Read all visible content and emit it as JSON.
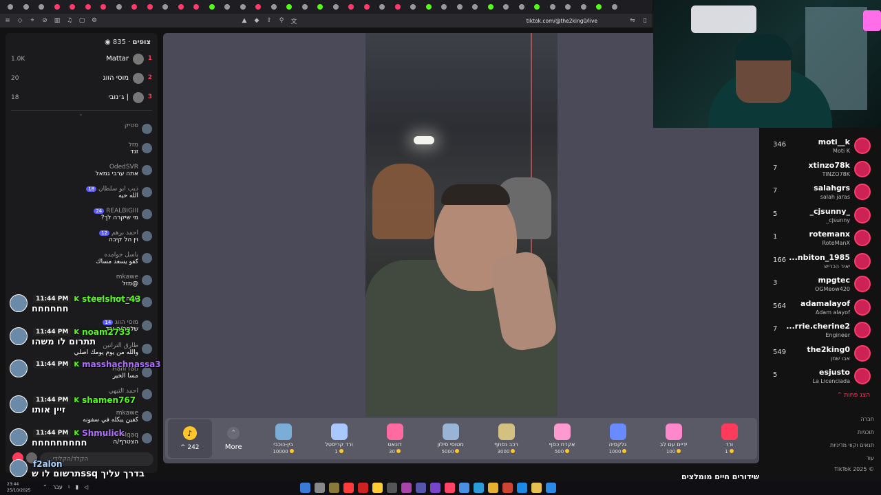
{
  "browser": {
    "url": "tiktok.com/@the2king0/live",
    "tab_colors": [
      "#999",
      "#999",
      "#999",
      "#ff3b6b",
      "#ff3b6b",
      "#ff3b6b",
      "#ff3b6b",
      "#999",
      "#ff3b6b",
      "#ff3b6b",
      "#999",
      "#ff3b6b",
      "#ff3b6b",
      "#53fc18",
      "#999",
      "#999",
      "#ff3b6b",
      "#999",
      "#53fc18",
      "#999",
      "#53fc18",
      "#999",
      "#ff3b6b",
      "#ff3b6b",
      "#999",
      "#ff3b6b",
      "#999",
      "#53fc18",
      "#999",
      "#999",
      "#999",
      "#53fc18",
      "#999",
      "#999",
      "#53fc18",
      "#999",
      "#999",
      "#999",
      "#53fc18",
      "#999"
    ]
  },
  "leftpanel": {
    "viewers_label": "צופים",
    "viewers_count": "835",
    "top_viewers": [
      {
        "rank": "1",
        "name": "Mattar",
        "score": "1.0K"
      },
      {
        "rank": "2",
        "name": "מוסי הווג",
        "score": "20"
      },
      {
        "rank": "3",
        "name": "ג׳נובי |",
        "score": "18"
      }
    ],
    "messages": [
      {
        "user": "סטיק",
        "text": ""
      },
      {
        "user": "מזל",
        "text": "זנד"
      },
      {
        "user": "OdedSVR",
        "text": "אתה ערבי גמאל"
      },
      {
        "user": "ذيب ابو سلطان",
        "text": "الله حيه",
        "badge": "18"
      },
      {
        "user": "REALBIGIII",
        "text": "מי שיקרה לך?",
        "badge": "24"
      },
      {
        "user": "احمد برهم",
        "text": "וין הל קיבה",
        "badge": "12"
      },
      {
        "user": "باسل حوامده",
        "text": "كفو يسعد مساك"
      },
      {
        "user": "mkawe",
        "text": "@מזל"
      },
      {
        "user": "",
        "text": "אתה ערבי ג׳מאל"
      },
      {
        "user": "מוסי הווג",
        "text": "שלחה/ה ורד",
        "badge": "14"
      },
      {
        "user": "طارق التراتين",
        "text": "والله من يوم يومك اصلي"
      },
      {
        "user": "Hani fatl",
        "text": "مسا الخير"
      },
      {
        "user": "احمد التيهي",
        "text": ""
      },
      {
        "user": "mkawe",
        "text": "كفين يبكله في سفونه"
      },
      {
        "user": "Mohamad Alqaq",
        "text": "הצטרף/ה"
      }
    ],
    "input_placeholder": "הקלד/הקלידי..."
  },
  "overlay_chat": [
    {
      "time": "11:44 PM",
      "name": "steelshot_43",
      "color": "#53fc18",
      "text": "חחחחחח"
    },
    {
      "time": "11:44 PM",
      "name": "noam2733",
      "color": "#53fc18",
      "text": "תתרום לו משהו"
    },
    {
      "time": "11:44 PM",
      "name": "masshachnassa3",
      "color": "#b070ff",
      "text": ""
    },
    {
      "time": "11:44 PM",
      "name": "shamen767",
      "color": "#53fc18",
      "text": "זיין אותו"
    },
    {
      "time": "11:44 PM",
      "name": "Shmulick",
      "color": "#b070ff",
      "text": "חחחחחחחחח"
    },
    {
      "time": "",
      "name": "f2alon",
      "color": "#aad4ff",
      "text": "בדרך עליך ssqתרשום לו ש"
    }
  ],
  "stage": {
    "coins": "242",
    "more_label": "More",
    "gifts": [
      {
        "name": "בין-כוכבי",
        "price": "10000",
        "color": "#7aaed8"
      },
      {
        "name": "ורד קריסטל",
        "price": "1",
        "color": "#a8c8ff"
      },
      {
        "name": "דונאט",
        "price": "30",
        "color": "#ff6aa0"
      },
      {
        "name": "מטוסי סילון",
        "price": "5000",
        "color": "#9ab4d8"
      },
      {
        "name": "רכב נסחף",
        "price": "3000",
        "color": "#d4c080"
      },
      {
        "name": "אקדח כסף",
        "price": "500",
        "color": "#ff9ad0"
      },
      {
        "name": "גלקסיה",
        "price": "1000",
        "color": "#6a8aff"
      },
      {
        "name": "ידיים עם לב",
        "price": "100",
        "color": "#ff88cc"
      },
      {
        "name": "ורד",
        "price": "1",
        "color": "#ff3b5c"
      }
    ]
  },
  "rightpanel": {
    "rows": [
      {
        "score": "346",
        "name": "moti__k",
        "sub": "Moti K"
      },
      {
        "score": "7",
        "name": "xtinzo78k",
        "sub": "TINZO78K"
      },
      {
        "score": "7",
        "name": "salahgrs",
        "sub": "salah jaras"
      },
      {
        "score": "5",
        "name": "_cjsunny_",
        "sub": "_cjsunny"
      },
      {
        "score": "1",
        "name": "rotemanx",
        "sub": "RoteManX"
      },
      {
        "score": "166",
        "name": "...nbiton_1985",
        "sub": "יאיר הכריש"
      },
      {
        "score": "3",
        "name": "mpgtec",
        "sub": "OGMeow420"
      },
      {
        "score": "564",
        "name": "adamalayof",
        "sub": "Adam alayof"
      },
      {
        "score": "7",
        "name": "...rrie.cherine2",
        "sub": "Engineer"
      },
      {
        "score": "549",
        "name": "the2king0",
        "sub": "אבו שמן"
      },
      {
        "score": "5",
        "name": "esjusto",
        "sub": "La Licenciada"
      }
    ],
    "show_less": "הצג פחות",
    "footer_links": [
      "חברה",
      "תוכניות",
      "תנאים וקווי מדיניות",
      "עוד"
    ],
    "copyright": "TikTok 2025 ©",
    "suggested_title": "שידורים חיים מומלצים"
  },
  "taskbar": {
    "time": "23:44",
    "date": "25/10/2025",
    "lang": "עבר",
    "app_colors": [
      "#3a7bd5",
      "#888",
      "#8a7a3a",
      "#ff3b3b",
      "#cc2222",
      "#ffcc33",
      "#555",
      "#aa44aa",
      "#5555aa",
      "#7744cc",
      "#ff4466",
      "#4a90e2",
      "#2a9ad8",
      "#e8b030",
      "#cc4433",
      "#1a8ae6",
      "#e8c050",
      "#2a8ae6"
    ]
  }
}
